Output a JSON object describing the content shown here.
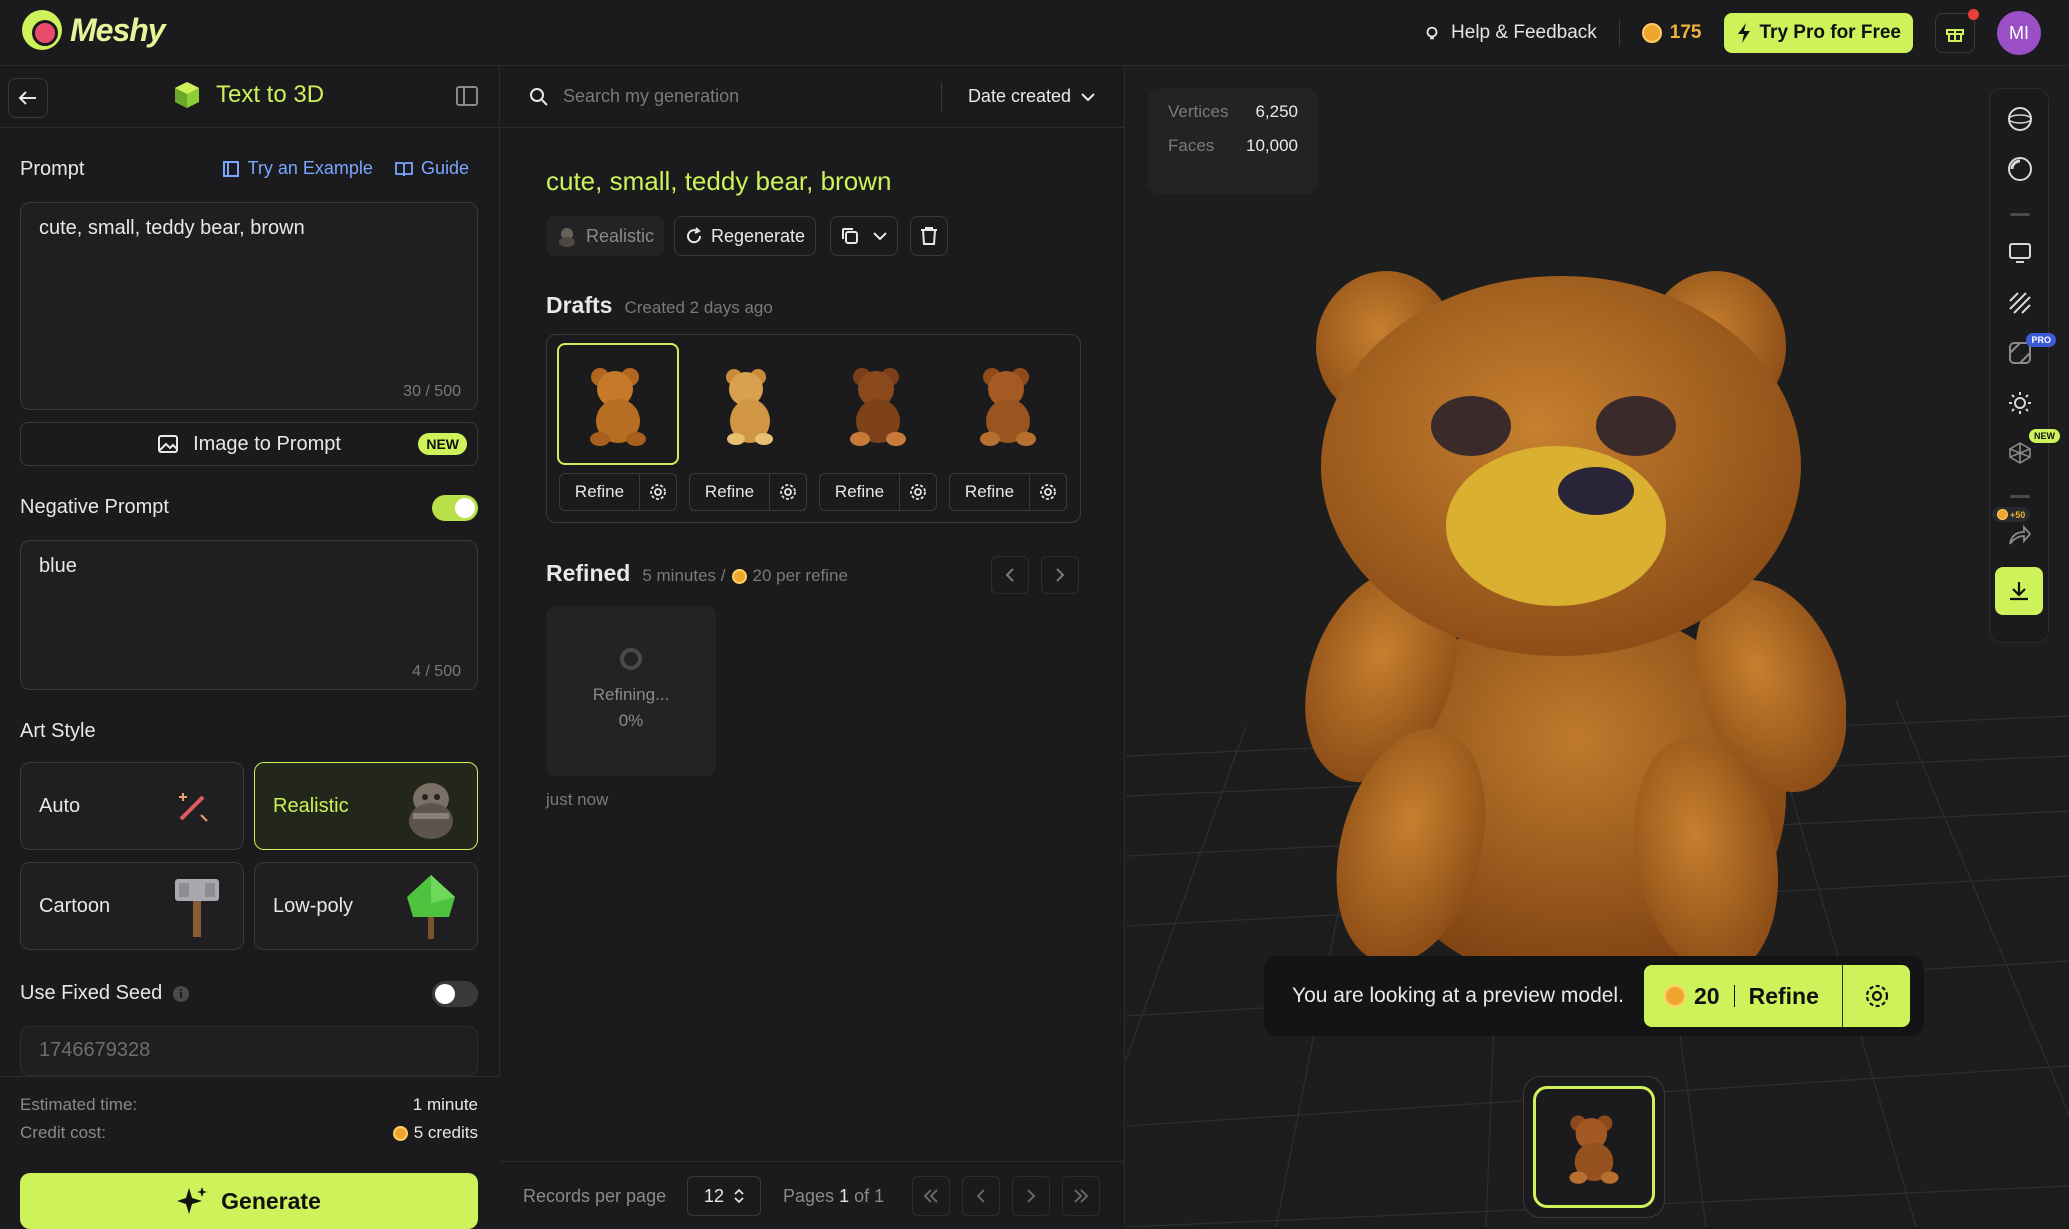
{
  "app": {
    "name": "Meshy"
  },
  "topbar": {
    "help_label": "Help & Feedback",
    "credits": "175",
    "pro_label": "Try Pro for Free",
    "avatar_initials": "MI"
  },
  "left": {
    "title": "Text to 3D",
    "prompt_label": "Prompt",
    "try_example": "Try an Example",
    "guide": "Guide",
    "prompt_value": "cute, small, teddy bear, brown",
    "prompt_counter": "30 / 500",
    "image_to_prompt": "Image to Prompt",
    "new_badge": "NEW",
    "negative_label": "Negative Prompt",
    "negative_enabled": true,
    "negative_value": "blue",
    "negative_counter": "4 / 500",
    "art_style_label": "Art Style",
    "styles": [
      {
        "label": "Auto",
        "icon": "magic-wand-icon",
        "selected": false
      },
      {
        "label": "Realistic",
        "icon": "realistic-thumbnail",
        "selected": true
      },
      {
        "label": "Cartoon",
        "icon": "cartoon-thumbnail",
        "selected": false
      },
      {
        "label": "Low-poly",
        "icon": "lowpoly-tree-thumbnail",
        "selected": false
      }
    ],
    "seed_label": "Use Fixed Seed",
    "seed_enabled": false,
    "seed_placeholder": "1746679328",
    "est_time_label": "Estimated time:",
    "est_time_value": "1 minute",
    "credit_cost_label": "Credit cost:",
    "credit_cost_value": "5 credits",
    "generate_label": "Generate"
  },
  "middle": {
    "search_placeholder": "Search my generation",
    "sort_label": "Date created",
    "gen_title": "cute, small, teddy bear, brown",
    "style_chip": "Realistic",
    "regenerate": "Regenerate",
    "drafts_title": "Drafts",
    "drafts_meta": "Created 2 days ago",
    "refine_label": "Refine",
    "refined_title": "Refined",
    "refined_meta": "5 minutes /",
    "per_refine": "20 per refine",
    "refining_text": "Refining...",
    "refining_pct": "0%",
    "just_now": "just now",
    "records_label": "Records per page",
    "records_value": "12",
    "pages_label": "Pages",
    "page_current": "1",
    "page_of": "of 1"
  },
  "viewer": {
    "vertices_label": "Vertices",
    "vertices_value": "6,250",
    "faces_label": "Faces",
    "faces_value": "10,000",
    "rail_tags": {
      "pro": "PRO",
      "new": "NEW",
      "plus50": "+50"
    },
    "preview_text": "You are looking at a preview model.",
    "refine_cost": "20",
    "refine_label": "Refine"
  },
  "colors": {
    "accent": "#cdf25a",
    "link": "#7aa6ff",
    "coin": "#f0a52e"
  }
}
